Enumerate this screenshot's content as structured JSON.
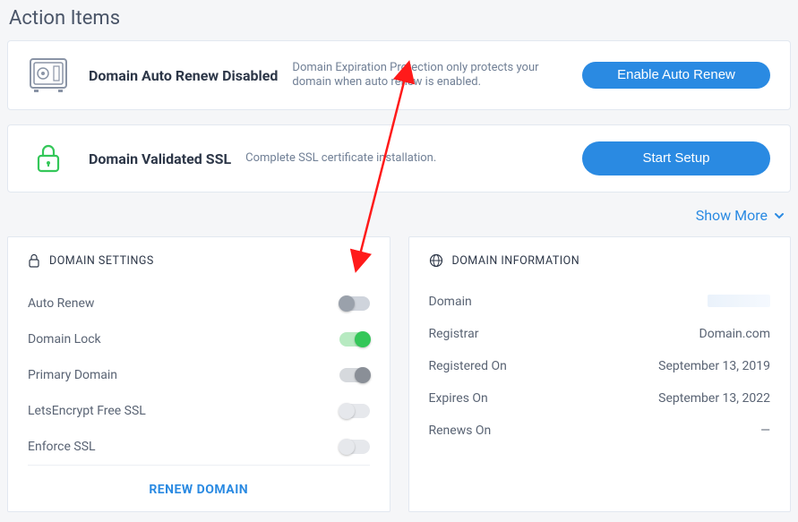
{
  "page": {
    "title": "Action Items",
    "show_more_label": "Show More"
  },
  "actionCards": [
    {
      "title": "Domain Auto Renew Disabled",
      "subtitle": "Domain Expiration Protection only protects your domain when auto renew is enabled.",
      "button": "Enable Auto Renew",
      "icon": "safe"
    },
    {
      "title": "Domain Validated SSL",
      "subtitle": "Complete SSL certificate installation.",
      "button": "Start Setup",
      "icon": "lock-green"
    }
  ],
  "settingsPanel": {
    "header": "DOMAIN SETTINGS",
    "rows": [
      {
        "label": "Auto Renew",
        "state": "off-gray"
      },
      {
        "label": "Domain Lock",
        "state": "on-green"
      },
      {
        "label": "Primary Domain",
        "state": "on-gray"
      },
      {
        "label": "LetsEncrypt Free SSL",
        "state": "off-light"
      },
      {
        "label": "Enforce SSL",
        "state": "off-light"
      }
    ],
    "footer": "RENEW DOMAIN"
  },
  "infoPanel": {
    "header": "DOMAIN INFORMATION",
    "rows": [
      {
        "label": "Domain",
        "value": "",
        "redacted": true
      },
      {
        "label": "Registrar",
        "value": "Domain.com"
      },
      {
        "label": "Registered On",
        "value": "September 13, 2019"
      },
      {
        "label": "Expires On",
        "value": "September 13, 2022"
      },
      {
        "label": "Renews On",
        "value": "—"
      }
    ]
  }
}
